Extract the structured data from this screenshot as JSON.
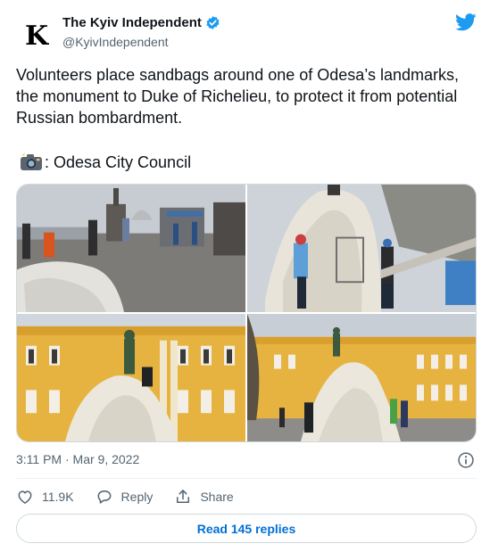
{
  "account": {
    "logo_letter": "K",
    "name": "The Kyiv Independent",
    "handle": "@KyivIndependent"
  },
  "tweet": {
    "text": "Volunteers place sandbags around one of Odesa’s landmarks, the monument to Duke of Richelieu, to protect it from potential Russian bombardment.",
    "credit": ": Odesa City Council",
    "timestamp": "3:11 PM · Mar 9, 2022"
  },
  "actions": {
    "likes": "11.9K",
    "reply_label": "Reply",
    "share_label": "Share"
  },
  "read_replies_label": "Read 145 replies",
  "colors": {
    "brand_blue": "#1d9bf0",
    "link_blue": "#006fd6",
    "secondary_text": "#536471",
    "building_yellow": "#e6b340"
  },
  "icons": [
    "verified-icon",
    "twitter-bird-icon",
    "camera-icon",
    "info-icon",
    "heart-icon",
    "reply-icon",
    "share-icon"
  ]
}
